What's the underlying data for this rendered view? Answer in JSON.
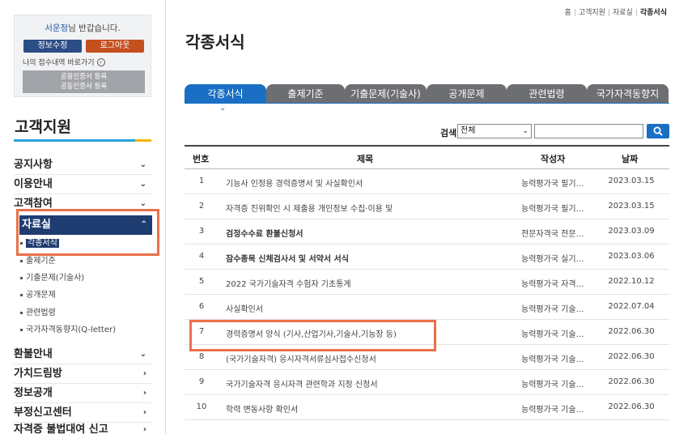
{
  "login": {
    "username": "서운정",
    "greeting_suffix": "님 반갑습니다.",
    "edit_button": "정보수정",
    "logout_button": "로그아웃",
    "my_applications_link": "나의 접수내역 바로가기",
    "cert_line1": "공용인증서 등록",
    "cert_line2": "공동인증서 등록"
  },
  "sidebar": {
    "title": "고객지원",
    "menu": [
      {
        "label": "공지사항",
        "chevron": "⌄"
      },
      {
        "label": "이용안내",
        "chevron": "⌄"
      },
      {
        "label": "고객참여",
        "chevron": "⌄"
      }
    ],
    "active_menu": {
      "label": "자료실",
      "chevron": "⌃"
    },
    "submenu": [
      {
        "label": "각종서식"
      },
      {
        "label": "출제기준"
      },
      {
        "label": "기출문제(기술사)"
      },
      {
        "label": "공개문제"
      },
      {
        "label": "관련법령"
      },
      {
        "label": "국가자격동향지(Q-letter)"
      }
    ],
    "menu_bottom": [
      {
        "label": "환불안내",
        "chevron": "⌄"
      },
      {
        "label": "가치드림방",
        "chevron": "›"
      },
      {
        "label": "정보공개",
        "chevron": "›"
      },
      {
        "label": "부정신고센터",
        "chevron": "›"
      },
      {
        "label": "자격증 불법대여 신고",
        "chevron": "›"
      }
    ]
  },
  "breadcrumb": {
    "home": "홈",
    "level1": "고객지원",
    "level2": "자료실",
    "current": "각종서식",
    "separator": "|"
  },
  "page_title": "각종서식",
  "tabs": [
    {
      "label": "각종서식"
    },
    {
      "label": "출제기준"
    },
    {
      "label": "기출문제(기술사)"
    },
    {
      "label": "공개문제"
    },
    {
      "label": "관련법령"
    },
    {
      "label": "국가자격동향지"
    }
  ],
  "search": {
    "label": "검색",
    "select_value": "전체",
    "input_value": ""
  },
  "table": {
    "headers": {
      "num": "번호",
      "title": "제목",
      "author": "작성자",
      "date": "날짜"
    },
    "rows": [
      {
        "num": "1",
        "title": "기능사 인정용 경력증명서 및 사실확인서",
        "author": "능력평가국 필기...",
        "date": "2023.03.15"
      },
      {
        "num": "2",
        "title": "자격증 진위확인 시 제출용 개인정보 수집·이용 및",
        "author": "능력평가국 필기...",
        "date": "2023.03.15"
      },
      {
        "num": "3",
        "title": "검정수수료 환불신청서",
        "author": "전문자격국 전문...",
        "date": "2023.03.09"
      },
      {
        "num": "4",
        "title": "잠수종목 신체검사서 및 서약서 서식",
        "author": "능력평가국 실기...",
        "date": "2023.03.06"
      },
      {
        "num": "5",
        "title": "2022 국가기술자격 수험자 기초통계",
        "author": "능력평가국 자격...",
        "date": "2022.10.12"
      },
      {
        "num": "6",
        "title": "사실확인서",
        "author": "능력평가국 기술...",
        "date": "2022.07.04"
      },
      {
        "num": "7",
        "title": "경력증명서 양식 (기사,산업기사,기술사,기능장 등)",
        "author": "능력평가국 기술...",
        "date": "2022.06.30"
      },
      {
        "num": "8",
        "title": "(국가기술자격) 응시자격서류심사접수신청서",
        "author": "능력평가국 기술...",
        "date": "2022.06.30"
      },
      {
        "num": "9",
        "title": "국가기술자격 응시자격 관련학과 지정 신청서",
        "author": "능력평가국 기술...",
        "date": "2022.06.30"
      },
      {
        "num": "10",
        "title": "학력 변동사항 확인서",
        "author": "능력평가국 기술...",
        "date": "2022.06.30"
      }
    ]
  },
  "colors": {
    "accent_blue": "#1a6fc4",
    "nav_dark": "#1e3c70",
    "tab_gray": "#6d6e72",
    "logout_orange": "#c5501f",
    "highlight_orange": "#e9704a"
  }
}
